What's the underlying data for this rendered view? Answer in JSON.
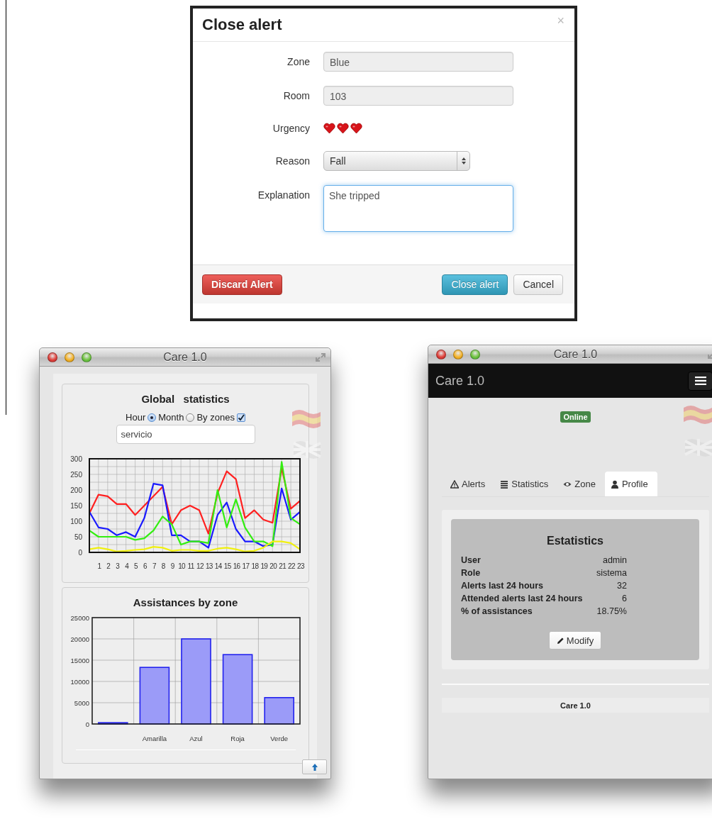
{
  "close_alert_dialog": {
    "title": "Close alert",
    "close": "×",
    "fields": [
      {
        "kind": "input",
        "label": "Zone",
        "value": "Blue"
      },
      {
        "kind": "input",
        "label": "Room",
        "value": "103"
      },
      {
        "kind": "hearts",
        "label": "Urgency",
        "stars": 3
      },
      {
        "kind": "select",
        "label": "Reason",
        "value": "Fall"
      },
      {
        "kind": "textarea",
        "label": "Explanation",
        "value": "She tripped",
        "focused": true
      }
    ],
    "buttons": [
      {
        "kind": "danger",
        "label": "Discard Alert"
      },
      {
        "kind": "primary",
        "label": "Close alert"
      },
      {
        "kind": "default",
        "label": "Cancel"
      }
    ]
  },
  "statistics_window": {
    "title": "Care 1.0",
    "card_title": "Global   statistics",
    "options": [
      {
        "kind": "radio",
        "label": "Hour",
        "selected": true
      },
      {
        "kind": "radio",
        "label": "Month",
        "selected": false
      },
      {
        "kind": "checkbox",
        "label": "By zones",
        "checked": true
      }
    ],
    "filter": {
      "value": "servicio"
    },
    "chart_data": {
      "type": "line",
      "grid": true,
      "x": [
        0,
        1,
        2,
        3,
        4,
        5,
        6,
        7,
        8,
        9,
        10,
        11,
        12,
        13,
        14,
        15,
        16,
        17,
        18,
        19,
        20,
        21,
        22,
        23
      ],
      "xlim": [
        0,
        23
      ],
      "ylim": [
        0,
        300
      ],
      "xticks": [
        1,
        2,
        3,
        4,
        5,
        6,
        7,
        8,
        9,
        10,
        11,
        12,
        13,
        14,
        15,
        16,
        17,
        18,
        19,
        20,
        21,
        22,
        23
      ],
      "yticks": [
        0,
        50,
        100,
        150,
        200,
        250,
        300
      ],
      "series": [
        {
          "color": "#ff2020",
          "values": [
            125,
            185,
            180,
            155,
            155,
            120,
            150,
            180,
            210,
            90,
            135,
            150,
            135,
            60,
            190,
            260,
            235,
            110,
            135,
            105,
            95,
            270,
            140,
            165
          ]
        },
        {
          "color": "#1a1aff",
          "values": [
            130,
            80,
            75,
            55,
            65,
            50,
            110,
            220,
            215,
            55,
            55,
            35,
            35,
            15,
            120,
            160,
            75,
            35,
            35,
            20,
            25,
            205,
            105,
            130
          ]
        },
        {
          "color": "#33ee11",
          "values": [
            70,
            50,
            50,
            50,
            50,
            40,
            45,
            70,
            115,
            90,
            25,
            35,
            35,
            30,
            200,
            80,
            170,
            80,
            35,
            35,
            20,
            290,
            110,
            90
          ]
        },
        {
          "color": "#f0f010",
          "values": [
            10,
            15,
            10,
            3,
            5,
            8,
            10,
            18,
            15,
            5,
            8,
            8,
            5,
            5,
            12,
            15,
            10,
            3,
            5,
            15,
            35,
            35,
            30,
            10
          ]
        }
      ]
    },
    "zones_chart": {
      "title": "Assistances by zone",
      "chart_data": {
        "type": "bar",
        "grid": true,
        "categories": [
          null,
          "Amarilla",
          "Azul",
          "Roja",
          "Verde"
        ],
        "values": [
          300,
          13300,
          20000,
          16300,
          6200
        ],
        "ylim": [
          0,
          25000
        ],
        "yticks": [
          0,
          5000,
          10000,
          15000,
          20000,
          25000
        ]
      }
    }
  },
  "profile_window": {
    "title": "Care 1.0",
    "brand": "Care 1.0",
    "status_badge": "Online",
    "tabs": [
      {
        "label": "Alerts",
        "selected": false
      },
      {
        "label": "Statistics",
        "selected": false
      },
      {
        "label": "Zone",
        "selected": false
      },
      {
        "label": "Profile",
        "selected": true
      }
    ],
    "card": {
      "title": "Estatistics",
      "rows": [
        {
          "label": "User",
          "value": "admin"
        },
        {
          "label": "Role",
          "value": "sistema"
        },
        {
          "label": "Alerts last 24 hours",
          "value": "32"
        },
        {
          "label": "Attended alerts last 24 hours",
          "value": "6"
        },
        {
          "label": "% of assistances",
          "value": "18.75%"
        }
      ],
      "button": "Modify"
    },
    "footer": "Care 1.0"
  }
}
